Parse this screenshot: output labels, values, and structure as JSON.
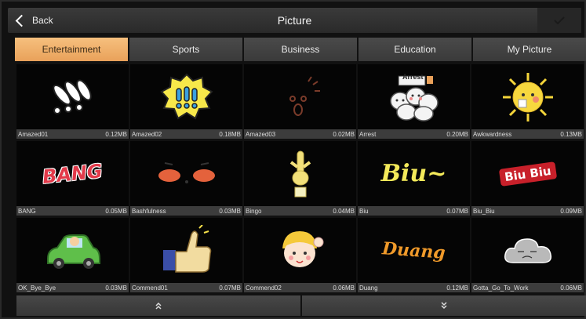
{
  "header": {
    "back_label": "Back",
    "title": "Picture"
  },
  "tabs": [
    {
      "label": "Entertainment",
      "active": true
    },
    {
      "label": "Sports",
      "active": false
    },
    {
      "label": "Business",
      "active": false
    },
    {
      "label": "Education",
      "active": false
    },
    {
      "label": "My Picture",
      "active": false
    }
  ],
  "pictures": [
    {
      "name": "Amazed01",
      "size": "0.12MB",
      "icon": "exclamation-marks-icon"
    },
    {
      "name": "Amazed02",
      "size": "0.18MB",
      "icon": "exclamation-bubble-icon"
    },
    {
      "name": "Amazed03",
      "size": "0.02MB",
      "icon": "surprised-face-icon"
    },
    {
      "name": "Arrest",
      "size": "0.20MB",
      "icon": "arrest-buns-icon",
      "text": "Arrest"
    },
    {
      "name": "Awkwardness",
      "size": "0.13MB",
      "icon": "awkward-sun-icon"
    },
    {
      "name": "BANG",
      "size": "0.05MB",
      "icon": "bang-text-icon",
      "text": "BANG"
    },
    {
      "name": "Bashfulness",
      "size": "0.03MB",
      "icon": "blushing-face-icon"
    },
    {
      "name": "Bingo",
      "size": "0.04MB",
      "icon": "bingo-hand-icon"
    },
    {
      "name": "Biu",
      "size": "0.07MB",
      "icon": "biu-text-icon",
      "text": "Biu~"
    },
    {
      "name": "Biu_Biu",
      "size": "0.09MB",
      "icon": "biu-biu-text-icon",
      "text": "Biu Biu"
    },
    {
      "name": "OK_Bye_Bye",
      "size": "0.03MB",
      "icon": "car-wave-icon"
    },
    {
      "name": "Commend01",
      "size": "0.07MB",
      "icon": "thumbs-up-icon"
    },
    {
      "name": "Commend02",
      "size": "0.06MB",
      "icon": "girl-thumbs-up-icon"
    },
    {
      "name": "Duang",
      "size": "0.12MB",
      "icon": "duang-text-icon",
      "text": "Duang"
    },
    {
      "name": "Gotta_Go_To_Work",
      "size": "0.06MB",
      "icon": "cloud-sad-icon"
    }
  ],
  "colors": {
    "accent_tab": "#e9a15a",
    "tile_bg": "#050505",
    "caption_bg": "#3c3c3c"
  }
}
